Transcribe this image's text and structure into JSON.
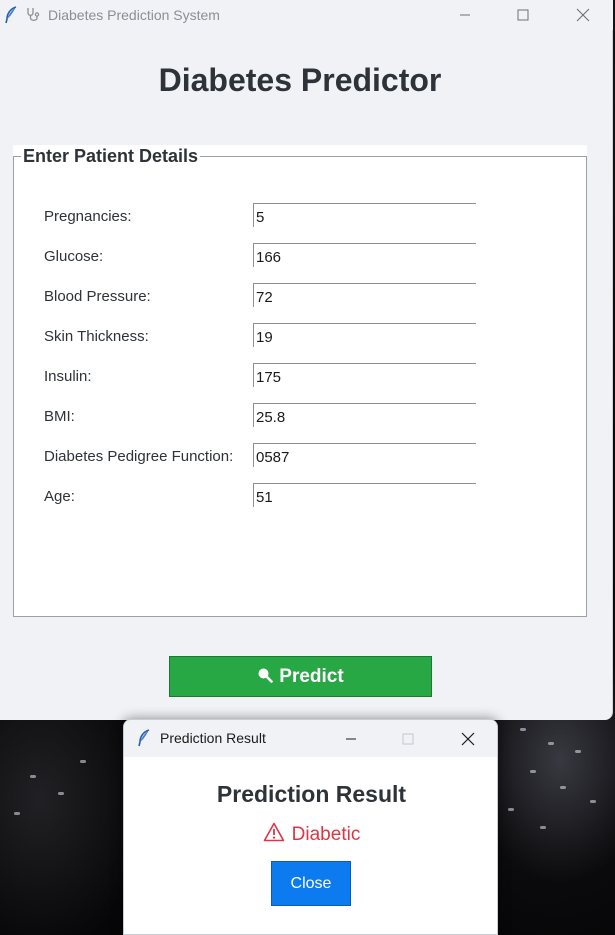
{
  "main_window": {
    "title": "Diabetes Prediction System",
    "heading": "Diabetes Predictor",
    "groupbox_title": "Enter Patient Details",
    "fields": [
      {
        "label": "Pregnancies:",
        "value": "5"
      },
      {
        "label": "Glucose:",
        "value": "166"
      },
      {
        "label": "Blood Pressure:",
        "value": "72"
      },
      {
        "label": "Skin Thickness:",
        "value": "19"
      },
      {
        "label": "Insulin:",
        "value": "175"
      },
      {
        "label": "BMI:",
        "value": "25.8"
      },
      {
        "label": "Diabetes Pedigree Function:",
        "value": "0587"
      },
      {
        "label": "Age:",
        "value": "51"
      }
    ],
    "predict_label": "Predict"
  },
  "dialog": {
    "title": "Prediction Result",
    "heading": "Prediction Result",
    "result": "Diabetic",
    "close_label": "Close"
  },
  "icons": {
    "app": "feather-icon",
    "title_glyph": "stethoscope-icon",
    "predict": "magnifier-icon",
    "result": "warning-icon"
  },
  "colors": {
    "predict_button": "#28a745",
    "close_button": "#0d7bf0",
    "result_text": "#dc3545",
    "window_bg": "#f0f2f5"
  }
}
